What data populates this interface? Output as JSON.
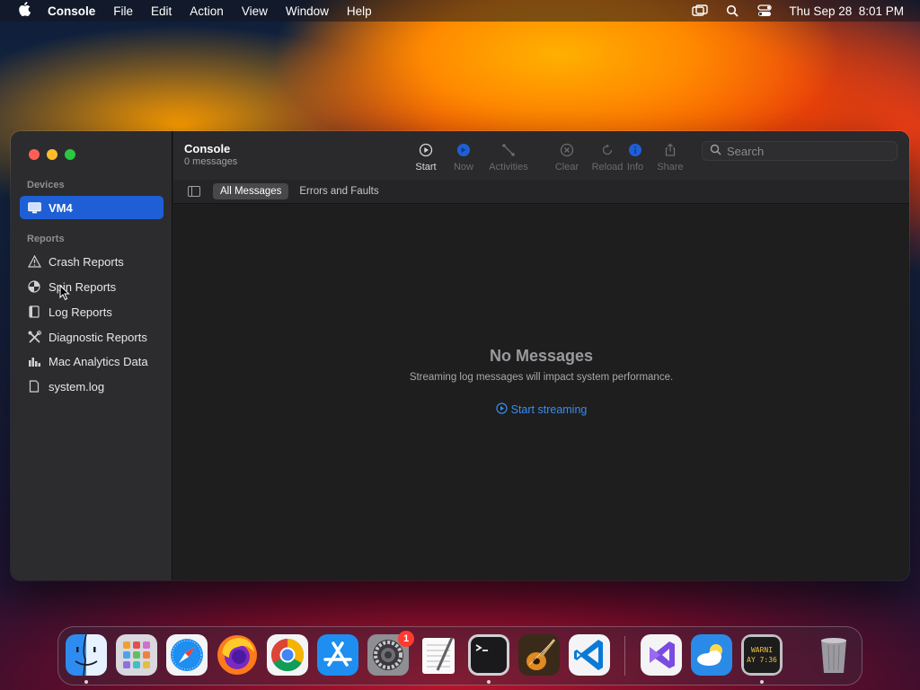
{
  "menubar": {
    "app_name": "Console",
    "items": [
      "File",
      "Edit",
      "Action",
      "View",
      "Window",
      "Help"
    ],
    "clock": "Thu Sep 28  8:01 PM"
  },
  "window": {
    "title": "Console",
    "subtitle": "0 messages",
    "sidebar": {
      "devices_header": "Devices",
      "devices": [
        {
          "label": "VM4",
          "icon": "monitor-icon",
          "selected": true
        }
      ],
      "reports_header": "Reports",
      "reports": [
        {
          "label": "Crash Reports",
          "icon": "warning-icon"
        },
        {
          "label": "Spin Reports",
          "icon": "spin-icon"
        },
        {
          "label": "Log Reports",
          "icon": "log-icon"
        },
        {
          "label": "Diagnostic Reports",
          "icon": "tools-icon"
        },
        {
          "label": "Mac Analytics Data",
          "icon": "chart-icon"
        },
        {
          "label": "system.log",
          "icon": "file-icon"
        }
      ]
    },
    "toolbar": {
      "start": "Start",
      "now": "Now",
      "activities": "Activities",
      "clear": "Clear",
      "reload": "Reload",
      "info": "Info",
      "share": "Share"
    },
    "search": {
      "placeholder": "Search"
    },
    "filters": {
      "all": "All Messages",
      "errors": "Errors and Faults"
    },
    "empty": {
      "title": "No Messages",
      "subtitle": "Streaming log messages will impact system performance.",
      "action": "Start streaming"
    }
  },
  "dock": {
    "apps": [
      "Finder",
      "Launchpad",
      "Safari",
      "Firefox",
      "Chrome",
      "App Store",
      "System Settings",
      "TextEdit",
      "Terminal",
      "GarageBand",
      "VS Code",
      "Visual Studio",
      "Weather",
      "Console",
      "Trash"
    ],
    "settings_badge": "1",
    "console_icon_text": "WARNI\nAY 7:36"
  },
  "colors": {
    "accent": "#1f5fd6",
    "link": "#3a8cf0"
  }
}
